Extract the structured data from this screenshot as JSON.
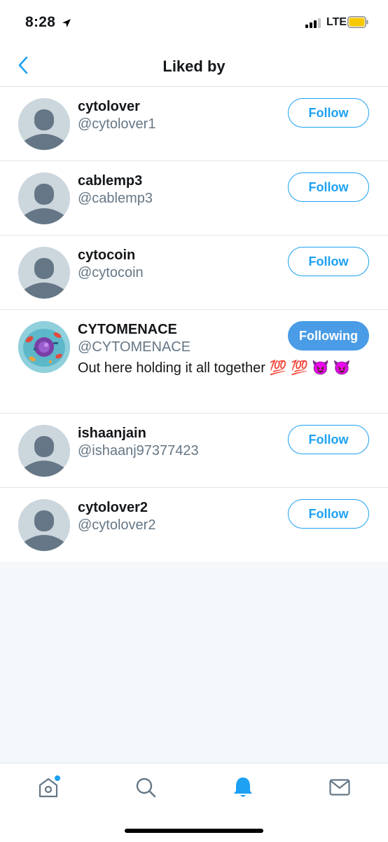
{
  "status_bar": {
    "time": "8:28",
    "network": "LTE"
  },
  "header": {
    "title": "Liked by"
  },
  "users": [
    {
      "name": "cytolover",
      "handle": "@cytolover1",
      "bio": "",
      "button": "Follow",
      "following": false
    },
    {
      "name": "cablemp3",
      "handle": "@cablemp3",
      "bio": "",
      "button": "Follow",
      "following": false
    },
    {
      "name": "cytocoin",
      "handle": "@cytocoin",
      "bio": "",
      "button": "Follow",
      "following": false
    },
    {
      "name": "CYTOMENACE",
      "handle": "@CYTOMENACE",
      "bio": "Out here holding it all together 💯 💯 😈 😈",
      "button": "Following",
      "following": true
    },
    {
      "name": "ishaanjain",
      "handle": "@ishaanj97377423",
      "bio": "",
      "button": "Follow",
      "following": false
    },
    {
      "name": "cytolover2",
      "handle": "@cytolover2",
      "bio": "",
      "button": "Follow",
      "following": false
    }
  ],
  "tabs": [
    {
      "icon": "home-icon",
      "active": false,
      "badge": true
    },
    {
      "icon": "search-icon",
      "active": false,
      "badge": false
    },
    {
      "icon": "notifications-bell-icon",
      "active": true,
      "badge": false
    },
    {
      "icon": "messages-envelope-icon",
      "active": false,
      "badge": false
    }
  ],
  "colors": {
    "accent": "#1da1f2",
    "following_bg": "#4a9ce6",
    "handle": "#657786",
    "battery": "#f7c900"
  }
}
